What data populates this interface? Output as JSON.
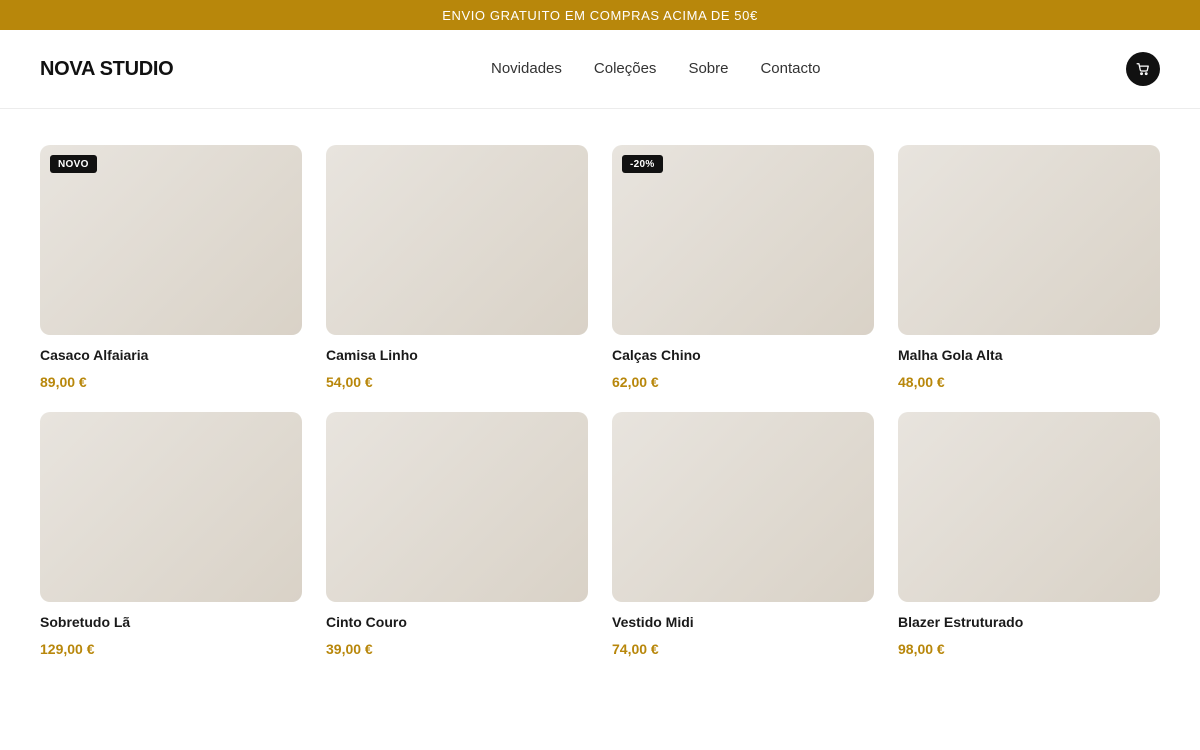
{
  "promo": {
    "text": "ENVIO GRATUITO EM COMPRAS ACIMA DE 50€"
  },
  "header": {
    "logo": "NOVA STUDIO",
    "nav": [
      "Novidades",
      "Coleções",
      "Sobre",
      "Contacto"
    ],
    "cart_icon": "cart-icon"
  },
  "colors": {
    "accent": "#b8870b",
    "dark": "#111111",
    "placeholder": "#e2ddd5"
  },
  "products": [
    {
      "name": "Casaco Alfaiaria",
      "price": "89,00 €",
      "badge": "NOVO"
    },
    {
      "name": "Camisa Linho",
      "price": "54,00 €",
      "badge": ""
    },
    {
      "name": "Calças Chino",
      "price": "62,00 €",
      "badge": "-20%"
    },
    {
      "name": "Malha Gola Alta",
      "price": "48,00 €",
      "badge": ""
    },
    {
      "name": "Sobretudo Lã",
      "price": "129,00 €",
      "badge": ""
    },
    {
      "name": "Cinto Couro",
      "price": "39,00 €",
      "badge": ""
    },
    {
      "name": "Vestido Midi",
      "price": "74,00 €",
      "badge": ""
    },
    {
      "name": "Blazer Estruturado",
      "price": "98,00 €",
      "badge": ""
    }
  ]
}
